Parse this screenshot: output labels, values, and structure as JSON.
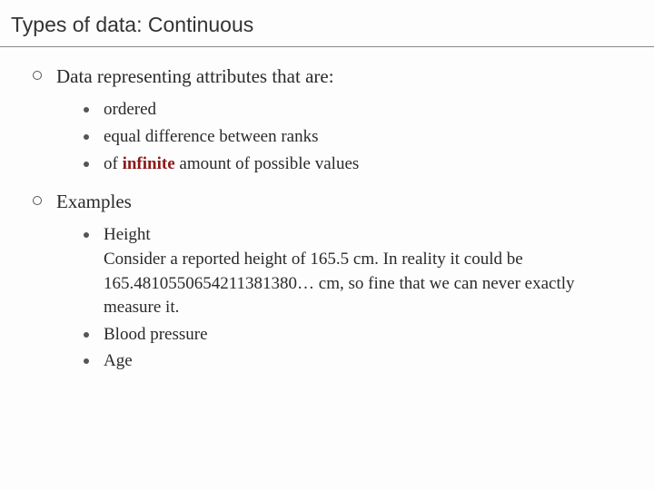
{
  "title": "Types of data: Continuous",
  "section1": {
    "heading": "Data representing attributes that are:",
    "items": [
      {
        "text": "ordered"
      },
      {
        "text": "equal difference between ranks"
      },
      {
        "prefix": "of ",
        "keyword": "infinite",
        "suffix": " amount of possible values"
      }
    ]
  },
  "section2": {
    "heading": "Examples",
    "items": [
      {
        "text": "Height\nConsider a reported height of 165.5 cm. In reality it could be 165.4810550654211381380… cm, so fine that we can never exactly measure it."
      },
      {
        "text": "Blood pressure"
      },
      {
        "text": "Age"
      }
    ]
  }
}
